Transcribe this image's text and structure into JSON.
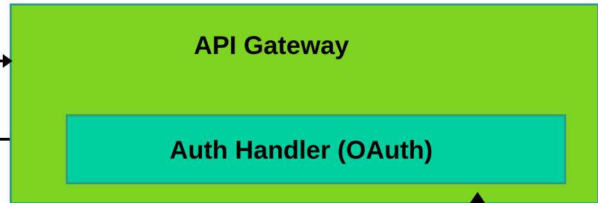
{
  "gateway": {
    "title": "API Gateway",
    "fill": "#7ed321",
    "border": "#2f9a8a"
  },
  "auth_handler": {
    "title": "Auth Handler (OAuth)",
    "fill": "#00cfa0",
    "border": "#2f9a8a"
  },
  "edges": [
    {
      "name": "incoming-arrow",
      "to": "API Gateway"
    },
    {
      "name": "outgoing-line",
      "from": "API Gateway"
    },
    {
      "name": "auth-arrow",
      "to": "Auth Handler (OAuth)"
    }
  ]
}
